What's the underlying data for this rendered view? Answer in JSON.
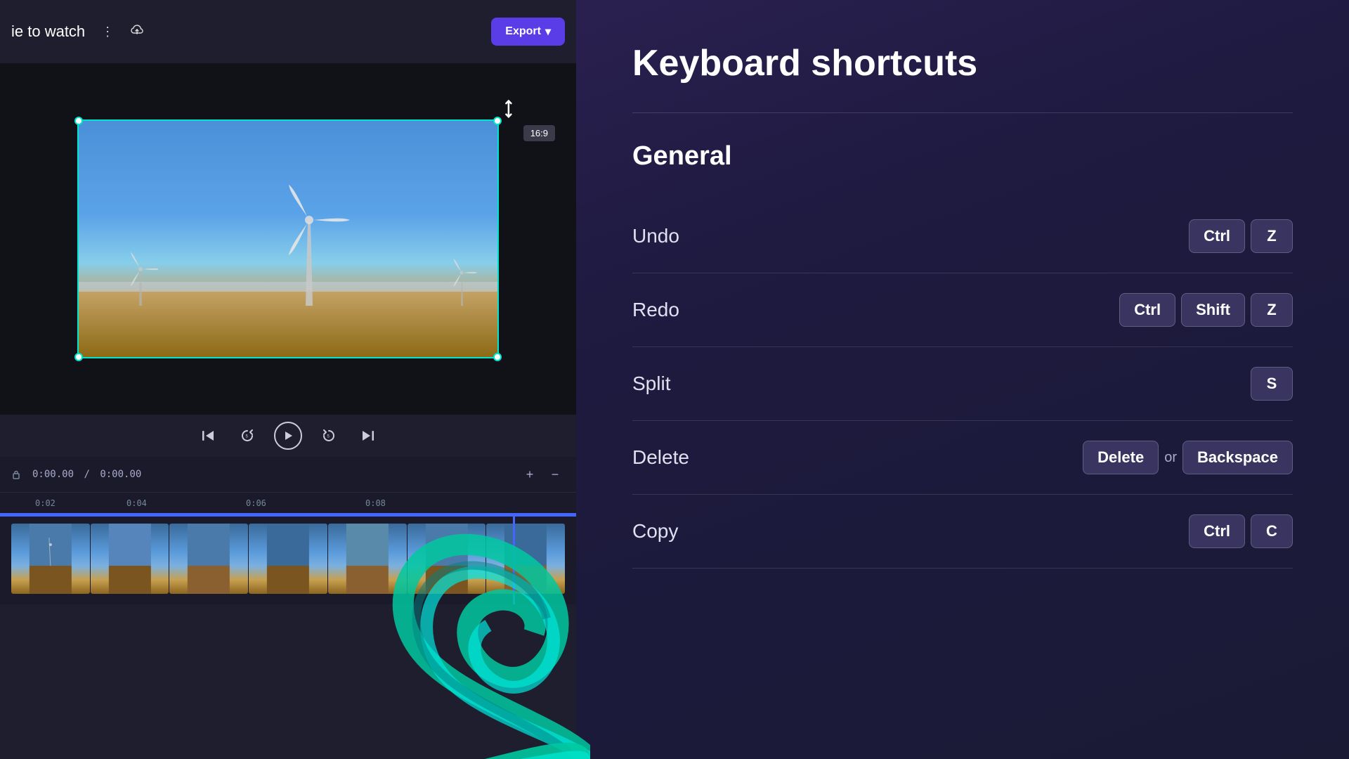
{
  "app": {
    "title": "ie to watch",
    "full_title": "Movie to watch"
  },
  "header": {
    "project_title": "ie to watch",
    "export_label": "Export",
    "export_dropdown_icon": "▾"
  },
  "preview": {
    "aspect_ratio": "16:9",
    "resize_icon": "↗"
  },
  "controls": {
    "skip_back_icon": "⏮",
    "replay_icon": "↺",
    "play_icon": "▶",
    "skip_forward_icon": "↻",
    "skip_end_icon": "⏭"
  },
  "timeline": {
    "current_time": "0:00.00",
    "total_time": "0:00.00",
    "separator": "/",
    "zoom_in": "+",
    "zoom_out": "−",
    "marks": [
      "0:02",
      "0:04",
      "0:06",
      "0:08"
    ]
  },
  "shortcuts": {
    "panel_title": "Keyboard shortcuts",
    "sections": [
      {
        "title": "General",
        "items": [
          {
            "name": "Undo",
            "keys": [
              "Ctrl",
              "Z"
            ],
            "connector": ""
          },
          {
            "name": "Redo",
            "keys": [
              "Ctrl",
              "Shift",
              "Z"
            ],
            "connector": ""
          },
          {
            "name": "Split",
            "keys": [
              "S"
            ],
            "connector": ""
          },
          {
            "name": "Delete",
            "keys": [
              "Delete",
              "Backspace"
            ],
            "connector": "or"
          },
          {
            "name": "Copy",
            "keys": [
              "Ctrl",
              "C"
            ],
            "connector": ""
          }
        ]
      }
    ]
  },
  "icons": {
    "more_options": "⋮",
    "cloud_upload": "☁",
    "lock": "🔒",
    "chevron_down": "▾"
  }
}
